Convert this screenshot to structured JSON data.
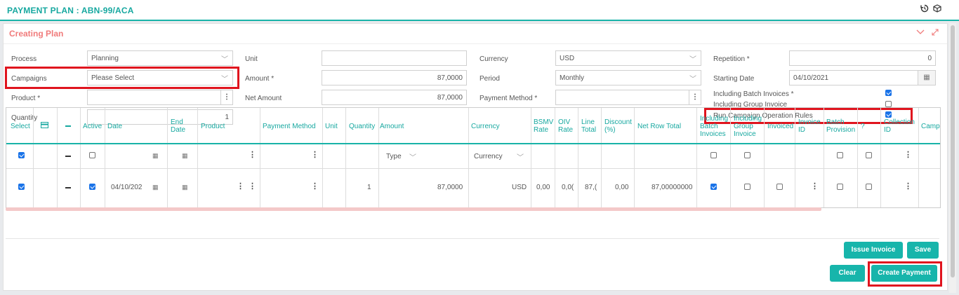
{
  "page": {
    "title": "PAYMENT PLAN : ABN-99/ACA",
    "icons": {
      "history": "history-icon",
      "cube": "cube-icon"
    }
  },
  "panel": {
    "title": "Creating Plan",
    "icons": {
      "collapse": "chevron-down-icon",
      "expand": "expand-icon"
    }
  },
  "form": {
    "process": {
      "label": "Process",
      "value": "Planning"
    },
    "campaigns": {
      "label": "Campaigns",
      "value": "Please Select"
    },
    "product": {
      "label": "Product *",
      "value": ""
    },
    "quantity": {
      "label": "Quantity",
      "value": "1"
    },
    "unit": {
      "label": "Unit",
      "value": ""
    },
    "amount": {
      "label": "Amount *",
      "value": "87,0000"
    },
    "net_amount": {
      "label": "Net Amount",
      "value": "87,0000"
    },
    "currency": {
      "label": "Currency",
      "value": "USD"
    },
    "period": {
      "label": "Period",
      "value": "Monthly"
    },
    "payment_method": {
      "label": "Payment Method *",
      "value": ""
    },
    "repetition": {
      "label": "Repetition *",
      "value": "0"
    },
    "starting_date": {
      "label": "Starting Date",
      "value": "04/10/2021"
    },
    "including_batch_invoices": {
      "label": "Including Batch Invoices *",
      "checked": true
    },
    "including_group_invoice": {
      "label": "Including Group Invoice",
      "checked": false
    },
    "run_campaign_rules": {
      "label": "Run Campaign Operation Rules",
      "checked": true
    }
  },
  "grid": {
    "headers": {
      "select": "Select",
      "active": "Active",
      "date": "Date",
      "end_date_1": "End",
      "end_date_2": "Date",
      "product": "Product",
      "payment_method": "Payment Method",
      "unit": "Unit",
      "quantity": "Quantity",
      "amount": "Amount",
      "currency": "Currency",
      "bsmv_1": "BSMV",
      "bsmv_2": "Rate",
      "oiv_1": "OIV",
      "oiv_2": "Rate",
      "line_total_1": "Line",
      "line_total_2": "Total",
      "discount_1": "Discount",
      "discount_2": "(%)",
      "net_row_total": "Net Row Total",
      "inc_batch_1": "Including",
      "inc_batch_2": "Batch",
      "inc_batch_3": "Invoices",
      "inc_group_1": "Including",
      "inc_group_2": "Group",
      "inc_group_3": "Invoice",
      "invoiced": "Invoiced",
      "invoice_id_1": "Invoice",
      "invoice_id_2": "ID",
      "batch_prov_1": "Batch",
      "batch_prov_2": "Provision",
      "question": "?",
      "collection_id_1": "Collection",
      "collection_id_2": "ID",
      "campaign_trunc": "Campa"
    },
    "filter_row": {
      "type_placeholder": "Type",
      "currency_placeholder": "Currency"
    },
    "rows": [
      {
        "date": "04/10/202",
        "quantity": "1",
        "amount": "87,0000",
        "currency": "USD",
        "bsmv_rate": "0,00",
        "oiv_rate": "0,0(",
        "line_total": "87,(",
        "discount": "0,00",
        "net_row_total": "87,00000000"
      }
    ]
  },
  "buttons": {
    "issue_invoice": "Issue Invoice",
    "save": "Save",
    "clear": "Clear",
    "create_payment": "Create Payment"
  },
  "colors": {
    "accent": "#17b5ab",
    "highlight": "#e0141e",
    "panel_title": "#f07b7b"
  }
}
